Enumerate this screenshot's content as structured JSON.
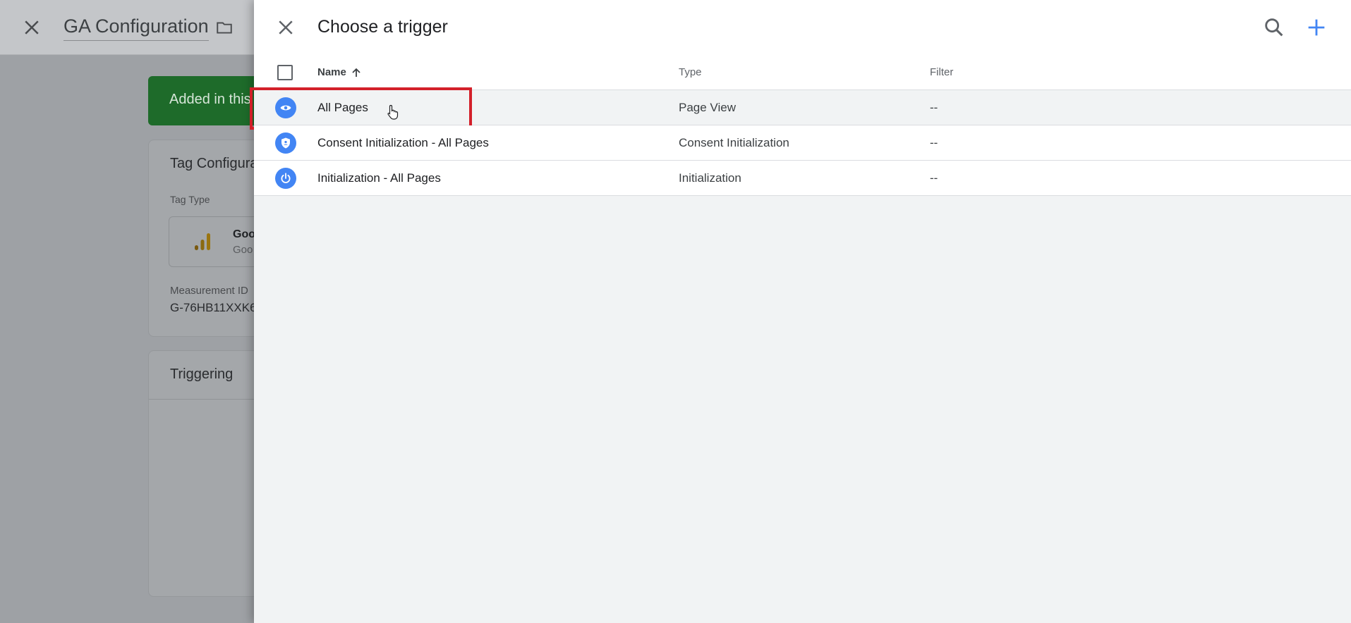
{
  "background": {
    "title": "GA Configuration",
    "banner": "Added in this",
    "tag_card": {
      "title": "Tag Configura",
      "tag_type_label": "Tag Type",
      "tag_type_name": "Goo",
      "tag_type_sub": "Goo",
      "measurement_label": "Measurement ID",
      "measurement_value": "G-76HB11XXK6"
    },
    "trigger_card": {
      "title": "Triggering"
    }
  },
  "panel": {
    "title": "Choose a trigger",
    "columns": {
      "name": "Name",
      "type": "Type",
      "filter": "Filter"
    },
    "rows": [
      {
        "name": "All Pages",
        "type": "Page View",
        "filter": "--",
        "icon": "eye-icon"
      },
      {
        "name": "Consent Initialization - All Pages",
        "type": "Consent Initialization",
        "filter": "--",
        "icon": "shield-icon"
      },
      {
        "name": "Initialization - All Pages",
        "type": "Initialization",
        "filter": "--",
        "icon": "power-icon"
      }
    ]
  },
  "colors": {
    "accent": "#4285f4",
    "highlight": "#d3202a",
    "banner": "#1e6b2a"
  }
}
